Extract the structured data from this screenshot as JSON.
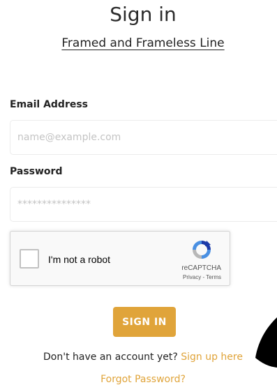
{
  "page": {
    "title": "Sign in",
    "subtitle": "Framed and Frameless Line"
  },
  "form": {
    "email_label": "Email Address",
    "email_placeholder": "name@example.com",
    "password_label": "Password",
    "password_placeholder": "***************",
    "submit_label": "SIGN IN"
  },
  "captcha": {
    "checkbox_label": "I'm not a robot",
    "brand": "reCAPTCHA",
    "links": "Privacy - Terms",
    "logo_icon": "recaptcha-icon"
  },
  "footer": {
    "signup_prompt": "Don't have an account yet?",
    "signup_link": "Sign up here",
    "forgot_link": "Forgot Password?"
  },
  "colors": {
    "accent": "#e0a43a",
    "field_border": "#ececec",
    "decoration": "#000000"
  }
}
